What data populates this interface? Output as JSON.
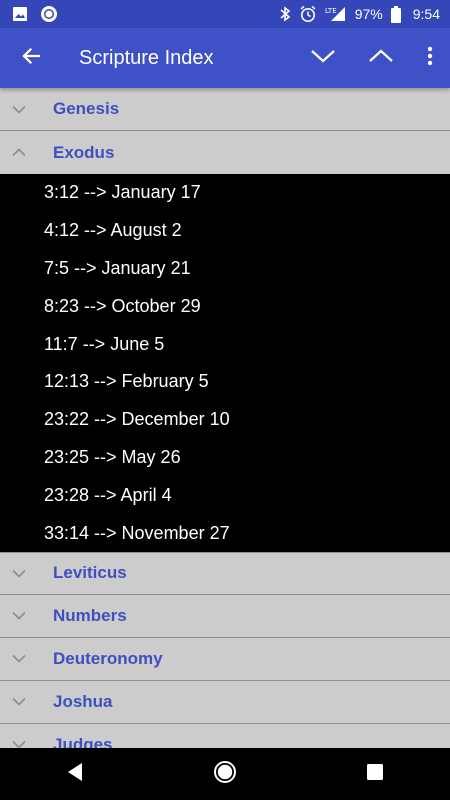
{
  "status_bar": {
    "time": "9:54",
    "battery_percent": "97%",
    "network_label": "LTE",
    "icons": [
      "image-icon",
      "circle-notification-icon",
      "bluetooth-icon",
      "alarm-icon",
      "signal-icon",
      "battery-icon"
    ]
  },
  "app_bar": {
    "title": "Scripture Index",
    "icons": [
      "back-arrow-icon",
      "chevron-down-icon",
      "chevron-up-icon",
      "overflow-menu-icon"
    ]
  },
  "groups": [
    {
      "label": "Genesis",
      "expanded": false
    },
    {
      "label": "Exodus",
      "expanded": true,
      "children": [
        "3:12 --> January 17",
        "4:12 --> August 2",
        "7:5 --> January 21",
        "8:23 --> October 29",
        "11:7 --> June 5",
        "12:13 --> February 5",
        "23:22 --> December 10",
        "23:25 --> May 26",
        "23:28 --> April 4",
        "33:14 --> November 27"
      ]
    },
    {
      "label": "Leviticus",
      "expanded": false
    },
    {
      "label": "Numbers",
      "expanded": false
    },
    {
      "label": "Deuteronomy",
      "expanded": false
    },
    {
      "label": "Joshua",
      "expanded": false
    },
    {
      "label": "Judges",
      "expanded": false
    }
  ],
  "nav_bar": {
    "icons": [
      "back-triangle-icon",
      "home-circle-icon",
      "recents-square-icon"
    ]
  },
  "colors": {
    "status_bar": "#3446b8",
    "app_bar": "#3f51c6",
    "group_bg": "#cccccc",
    "group_text": "#3f4fbf",
    "child_bg": "#000000",
    "child_text": "#ffffff"
  }
}
